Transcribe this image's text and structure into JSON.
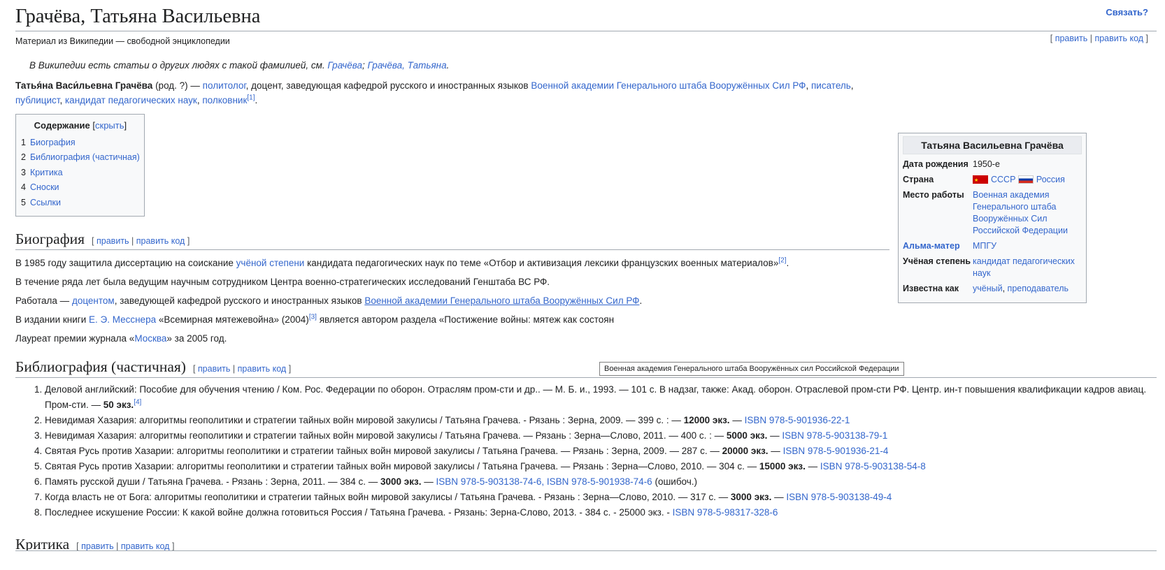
{
  "header": {
    "title": "Грачёва, Татьяна Васильевна",
    "connect": "Связать?",
    "site_sub": "Материал из Википедии — свободной энциклопедии",
    "edit": "править",
    "edit_code": "править код"
  },
  "hatnote": {
    "text": "В Википедии есть статьи о других людях с такой фамилией, см. ",
    "link1": "Грачёва",
    "sep": "; ",
    "link2": "Грачёва, Татьяна",
    "end": "."
  },
  "lead": {
    "name": "Татья́на Васи́льевна Грачёва",
    "t1": " (род. ?) — ",
    "l1": "политолог",
    "t2": ", доцент, заведующая кафедрой русского и иностранных языков ",
    "l2": "Военной академии Генерального штаба Вооружённых Сил РФ",
    "t3": ", ",
    "l3": "писатель",
    "t4": ", ",
    "l4": "публицист",
    "t5": ", ",
    "l5": "кандидат педагогических наук",
    "t6": ", ",
    "l6": "полковник",
    "ref": "[1]",
    "t7": "."
  },
  "toc": {
    "title": "Содержание",
    "hide": "скрыть",
    "items": [
      {
        "num": "1",
        "label": "Биография"
      },
      {
        "num": "2",
        "label": "Библиография (частичная)"
      },
      {
        "num": "3",
        "label": "Критика"
      },
      {
        "num": "4",
        "label": "Сноски"
      },
      {
        "num": "5",
        "label": "Ссылки"
      }
    ]
  },
  "infobox": {
    "title": "Татьяна Васильевна Грачёва",
    "birth_label": "Дата рождения",
    "birth_value": "1950-е",
    "country_label": "Страна",
    "country1": "СССР",
    "country2": "Россия",
    "work_label": "Место работы",
    "work_value": "Военная академия Генерального штаба Вооружённых Сил Российской Федерации",
    "alma_label": "Альма-матер",
    "alma_value": "МПГУ",
    "degree_label": "Учёная степень",
    "degree_value": "кандидат педагогических наук",
    "known_label": "Известна как",
    "known_l1": "учёный",
    "known_sep": ", ",
    "known_l2": "преподаватель"
  },
  "biography": {
    "heading": "Биография",
    "p1_a": "В 1985 году защитила диссертацию на соискание ",
    "p1_link": "учёной степени",
    "p1_b": " кандидата педагогических наук по теме «Отбор и активизация лексики французских военных материалов»",
    "p1_ref": "[2]",
    "p1_c": ".",
    "p2": "В течение ряда лет была ведущим научным сотрудником Центра военно-стратегических исследований Генштаба ВС РФ.",
    "p3_a": "Работала — ",
    "p3_link1": "доцентом",
    "p3_b": ", заведующей кафедрой русского и иностранных языков ",
    "p3_link2": "Военной академии Генерального штаба Вооружённых Сил РФ",
    "p3_c": ".",
    "p4_a": "В издании книги ",
    "p4_link": "Е. Э. Месснера",
    "p4_b": " «Всемирная мятежевойна» (2004)",
    "p4_ref": "[3]",
    "p4_c": " является автором раздела «Постижение войны: мятеж как состоян",
    "p5_a": "Лауреат премии журнала «",
    "p5_link": "Москва",
    "p5_b": "» за 2005 год.",
    "tooltip": "Военная академия Генерального штаба Вооружённых сил Российской Федерации"
  },
  "bibliography": {
    "heading": "Библиография (частичная)",
    "items": [
      {
        "text": "Деловой английский: Пособие для обучения чтению / Ком. Рос. Федерации по оборон. Отраслям пром-сти и др.. — М. Б. и., 1993. — 101 с. В надзаг, также: Акад. оборон. Отраслевой пром-сти РФ. Центр. ин-т повышения квалификации кадров авиац. Пром-сти. — ",
        "bold": "50 экз.",
        "after": "",
        "isbn": "",
        "ref": "[4]",
        "tail": ""
      },
      {
        "text": "Невидимая Хазария: алгоритмы геополитики и стратегии тайных войн мировой закулисы / Татьяна Грачева. - Рязань : Зерна, 2009. — 399 с. : — ",
        "bold": "12000 экз.",
        "after": " — ",
        "isbn": "ISBN 978-5-901936-22-1",
        "ref": "",
        "tail": ""
      },
      {
        "text": "Невидимая Хазария: алгоритмы геополитики и стратегии тайных войн мировой закулисы / Татьяна Грачева. — Рязань : Зерна—Слово, 2011. — 400 с. : — ",
        "bold": "5000 экз.",
        "after": " — ",
        "isbn": "ISBN 978-5-903138-79-1",
        "ref": "",
        "tail": ""
      },
      {
        "text": "Святая Русь против Хазарии: алгоритмы геополитики и стратегии тайных войн мировой закулисы / Татьяна Грачева. — Рязань : Зерна, 2009. — 287 с. — ",
        "bold": "20000 экз.",
        "after": " — ",
        "isbn": "ISBN 978-5-901936-21-4",
        "ref": "",
        "tail": ""
      },
      {
        "text": "Святая Русь против Хазарии: алгоритмы геополитики и стратегии тайных войн мировой закулисы / Татьяна Грачева. — Рязань : Зерна—Слово, 2010. — 304 с. — ",
        "bold": "15000 экз.",
        "after": " — ",
        "isbn": "ISBN 978-5-903138-54-8",
        "ref": "",
        "tail": ""
      },
      {
        "text": "Память русской души / Татьяна Грачева. - Рязань : Зерна, 2011. — 384 с. — ",
        "bold": "3000 экз.",
        "after": " — ",
        "isbn": "ISBN 978-5-903138-74-6, ISBN 978-5-901938-74-6",
        "ref": "",
        "tail": " (ошибоч.)"
      },
      {
        "text": "Когда власть не от Бога: алгоритмы геополитики и стратегии тайных войн мировой закулисы / Татьяна Грачева. - Рязань : Зерна—Слово, 2010. — 317 с. — ",
        "bold": "3000 экз.",
        "after": " — ",
        "isbn": "ISBN 978-5-903138-49-4",
        "ref": "",
        "tail": ""
      },
      {
        "text": "Последнее искушение России: К какой войне должна готовиться Россия / Татьяна Грачева. - Рязань: Зерна-Слово, 2013. - 384 с. - 25000 экз. - ",
        "bold": "",
        "after": "",
        "isbn": "ISBN 978-5-98317-328-6",
        "ref": "",
        "tail": ""
      }
    ]
  },
  "criticism": {
    "heading": "Критика"
  }
}
